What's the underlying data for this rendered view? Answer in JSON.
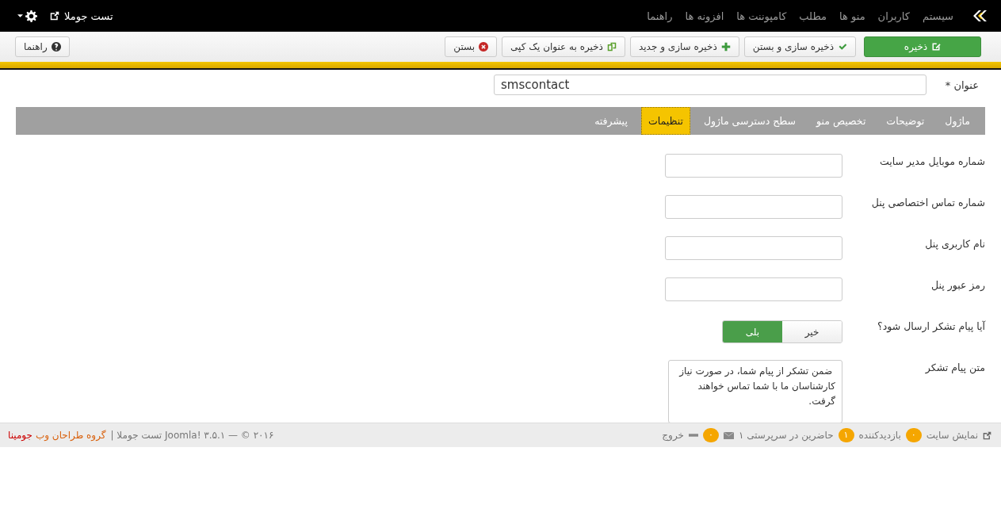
{
  "topbar": {
    "menu": [
      "سیستم",
      "کاربران",
      "منو ها",
      "مطلب",
      "کامپوننت ها",
      "افزونه ها",
      "راهنما"
    ],
    "site_link": "تست جوملا"
  },
  "toolbar": {
    "buttons": [
      {
        "label": "ذخیره",
        "kind": "primary"
      },
      {
        "label": "ذخیره سازی و بستن",
        "kind": "default"
      },
      {
        "label": "ذخیره سازی و جدید",
        "kind": "default"
      },
      {
        "label": "ذخیره به عنوان یک کپی",
        "kind": "default"
      },
      {
        "label": "بستن",
        "kind": "default"
      }
    ],
    "help": {
      "label": "راهنما"
    }
  },
  "title_field": {
    "label": "عنوان *",
    "value": "smscontact"
  },
  "tabs": [
    {
      "label": "ماژول",
      "selected": false
    },
    {
      "label": "توضیحات",
      "selected": false
    },
    {
      "label": "تخصیص منو",
      "selected": false
    },
    {
      "label": "سطح دسترسی ماژول",
      "selected": false
    },
    {
      "label": "تنظیمات",
      "selected": true
    },
    {
      "label": "پیشرفته",
      "selected": false
    }
  ],
  "fields": [
    {
      "kind": "text",
      "label": "شماره موبایل مدیر سایت"
    },
    {
      "kind": "text",
      "label": "شماره تماس اختصاصی پنل"
    },
    {
      "kind": "text",
      "label": "نام کاربری پنل"
    },
    {
      "kind": "text",
      "label": "رمز عبور پنل"
    },
    {
      "kind": "toggle",
      "label": "آیا پیام تشکر ارسال شود؟",
      "options": [
        {
          "label": "خیر",
          "selected": false
        },
        {
          "label": "بلی",
          "selected": true
        }
      ]
    },
    {
      "kind": "textarea",
      "label": "متن پیام تشکر",
      "value": " ضمن تشکر از پیام شما، در صورت نیاز کارشناسان ما با شما تماس خواهند گرفت."
    }
  ],
  "footer": {
    "view_site": "نمایش سایت",
    "visitors_count": "۰",
    "visitors": "بازدیدکننده",
    "admins_count": "۱",
    "admins": "حاضرین در سرپرستی ۱",
    "messages_count": "۰",
    "logout": "خروج",
    "copyright": "۲۰۱۶ © — ۳.۵.۱ !Joomla تست جوملا |",
    "credit": "گروه طراحان وب",
    "credit_brand": "جومینا"
  }
}
